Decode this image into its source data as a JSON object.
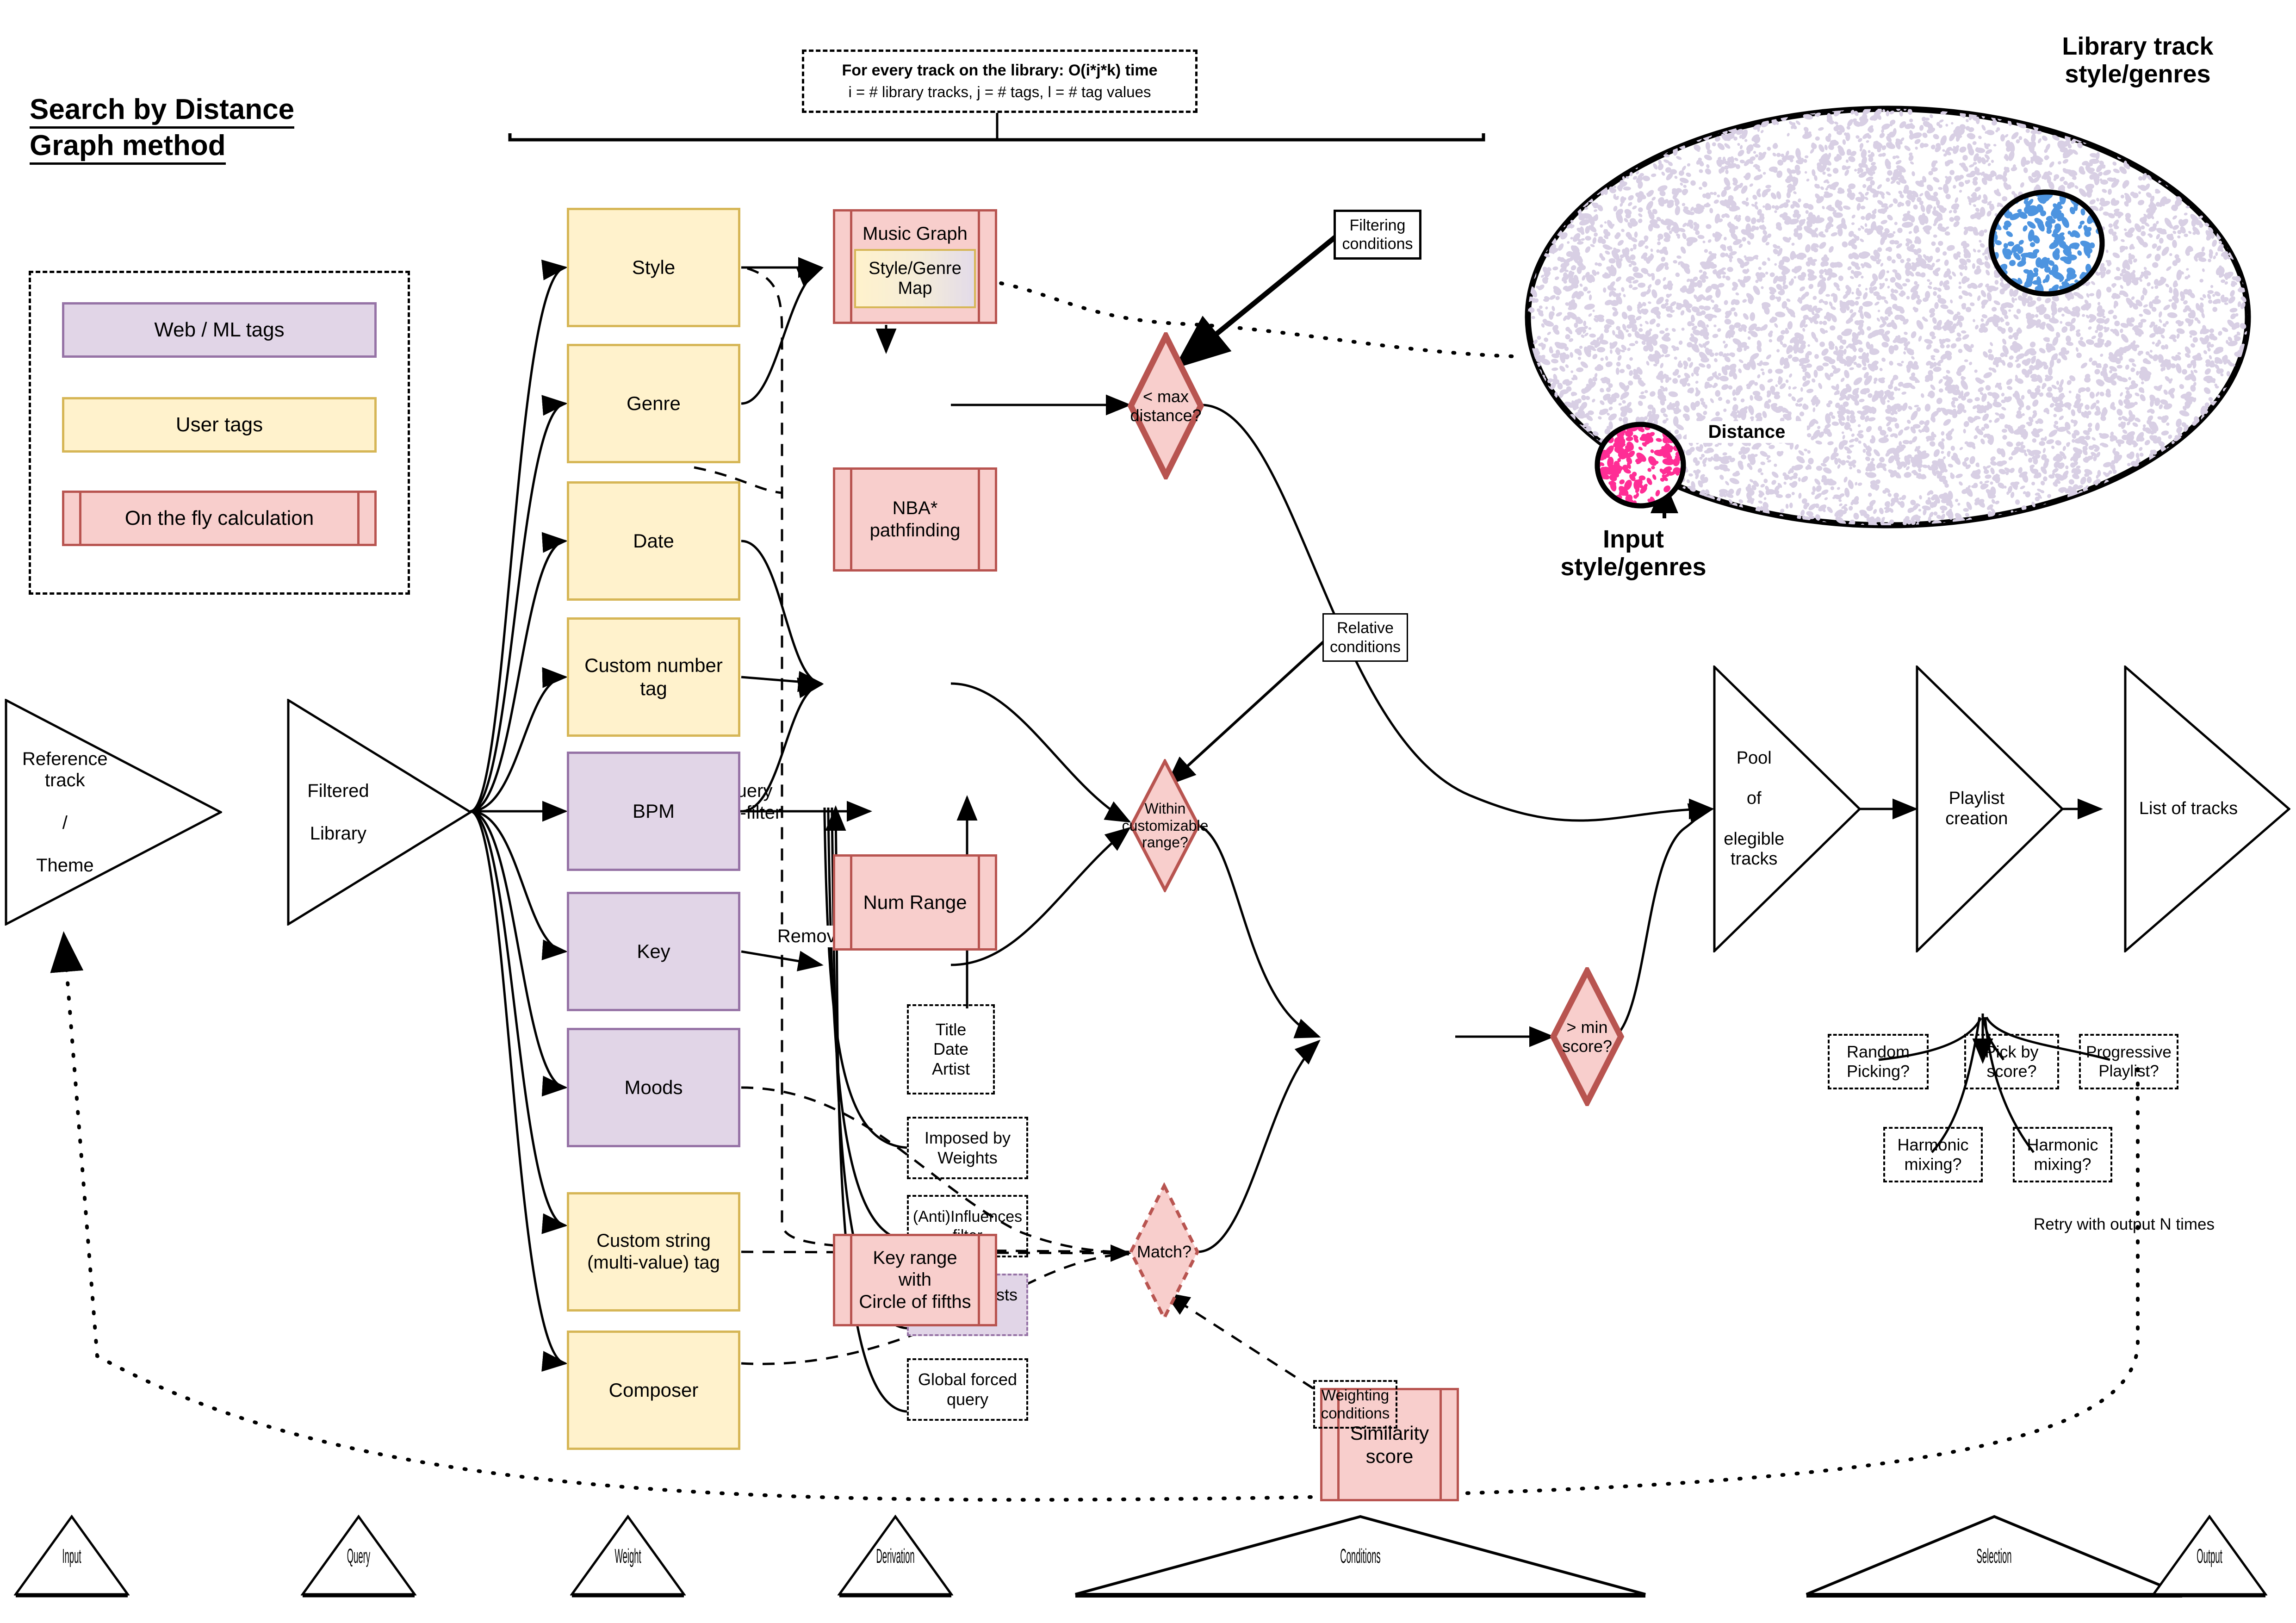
{
  "title": {
    "line1": "Search by Distance",
    "line2": "Graph method"
  },
  "legend": {
    "items": [
      {
        "label": "Web / ML tags",
        "kind": "web-ml-tags",
        "fill": "#e1d5e7",
        "stroke": "#9673a6"
      },
      {
        "label": "User tags",
        "kind": "user-tags",
        "fill": "#fff2cc",
        "stroke": "#d6b656"
      },
      {
        "label": "On the fly calculation",
        "kind": "on-the-fly-calculation",
        "fill": "#f8cecc",
        "stroke": "#b85450"
      }
    ]
  },
  "complexity_note": {
    "line1": "For every track on the  library: O(i*j*k) time",
    "line2": "i = # library tracks, j = # tags, l = # tag values"
  },
  "pipeline": {
    "reference_track": "Reference track\n/\nTheme",
    "reference_track_l1": "Reference track",
    "reference_track_l2": "/",
    "reference_track_l3": "Theme",
    "query_prefilter_l1": "Query",
    "query_prefilter_l2": "pre-filter",
    "filtered_library_l1": "Filtered",
    "filtered_library_l2": "Library",
    "remove_duplicates": "Remove duplicates",
    "pool_l1": "Pool",
    "pool_l2": "of",
    "pool_l3": "elegible tracks",
    "playlist_creation": "Playlist creation",
    "list_of_tracks": "List of tracks"
  },
  "prefilters": [
    {
      "label_l1": "Title",
      "label_l2": "Date",
      "label_l3": "Artist",
      "name": "title-date-artist"
    },
    {
      "label_l1": "Imposed by",
      "label_l2": "Weights",
      "name": "imposed-by-weights"
    },
    {
      "label_l1": "(Anti)Influences",
      "label_l2": "filter",
      "name": "anti-influences-filter"
    },
    {
      "label_l1": "Similar artists",
      "label_l2": "filter",
      "name": "similar-artists-filter",
      "highlight": true
    },
    {
      "label_l1": "Global forced",
      "label_l2": "query",
      "name": "global-forced-query"
    }
  ],
  "tags": [
    {
      "label": "Style",
      "type": "user",
      "name": "style"
    },
    {
      "label": "Genre",
      "type": "user",
      "name": "genre"
    },
    {
      "label": "Date",
      "type": "user",
      "name": "date"
    },
    {
      "label_l1": "Custom number",
      "label_l2": "tag",
      "type": "user",
      "name": "custom-number-tag"
    },
    {
      "label": "BPM",
      "type": "web-ml",
      "name": "bpm"
    },
    {
      "label": "Key",
      "type": "web-ml",
      "name": "key"
    },
    {
      "label": "Moods",
      "type": "web-ml",
      "name": "moods"
    },
    {
      "label_l1": "Custom string",
      "label_l2": "(multi-value) tag",
      "type": "user",
      "name": "custom-string-tag"
    },
    {
      "label": "Composer",
      "type": "user",
      "name": "composer"
    }
  ],
  "derivations": {
    "music_graph": {
      "title": "Music Graph",
      "inner": "Style/Genre\nMap",
      "inner_l1": "Style/Genre",
      "inner_l2": "Map"
    },
    "nba": {
      "l1": "NBA*",
      "l2": "pathfinding"
    },
    "num_range": "Num Range",
    "key_range": {
      "l1": "Key range",
      "l2": "with",
      "l3": "Circle of fifths"
    },
    "similarity_score": {
      "l1": "Similarity",
      "l2": "score"
    }
  },
  "decisions": {
    "max_distance": {
      "l1": "< max",
      "l2": "distance?"
    },
    "within_range": {
      "l1": "Within",
      "l2": "customizable",
      "l3": "range?"
    },
    "min_score": {
      "l1": "> min",
      "l2": "score?"
    },
    "match": {
      "l1": "Match?"
    }
  },
  "condition_boxes": {
    "filtering": {
      "l1": "Filtering",
      "l2": "conditions"
    },
    "relative": {
      "l1": "Relative",
      "l2": "conditions"
    },
    "weighting": {
      "l1": "Weighting",
      "l2": "conditions"
    }
  },
  "selection_options": [
    {
      "l1": "Random",
      "l2": "Picking?",
      "name": "random-picking"
    },
    {
      "l1": "Pick by",
      "l2": "score?",
      "name": "pick-by-score"
    },
    {
      "l1": "Progressive",
      "l2": "Playlist?",
      "name": "progressive-playlist"
    },
    {
      "l1": "Harmonic",
      "l2": "mixing?",
      "name": "harmonic-mixing-1"
    },
    {
      "l1": "Harmonic",
      "l2": "mixing?",
      "name": "harmonic-mixing-2"
    }
  ],
  "retry_label": "Retry with output N times",
  "cloud": {
    "library_label_l1": "Library track",
    "library_label_l2": "style/genres",
    "input_label_l1": "Input",
    "input_label_l2": "style/genres",
    "distance_label": "Distance",
    "colors": {
      "background_dots": "#d8cfe4",
      "input_cluster": "#ff2d95",
      "library_cluster": "#4d94e0"
    }
  },
  "phase_bands": [
    {
      "label": "Input",
      "name": "phase-input"
    },
    {
      "label": "Query",
      "name": "phase-query"
    },
    {
      "label": "Weight",
      "name": "phase-weight"
    },
    {
      "label": "Derivation",
      "name": "phase-derivation"
    },
    {
      "label": "Conditions",
      "name": "phase-conditions"
    },
    {
      "label": "Selection",
      "name": "phase-selection"
    },
    {
      "label": "Output",
      "name": "phase-output"
    }
  ],
  "colors": {
    "user_tag_fill": "#fff2cc",
    "user_tag_stroke": "#d6b656",
    "web_ml_fill": "#e1d5e7",
    "web_ml_stroke": "#9673a6",
    "calc_fill": "#f8cecc",
    "calc_stroke": "#b85450",
    "line": "#000000"
  }
}
